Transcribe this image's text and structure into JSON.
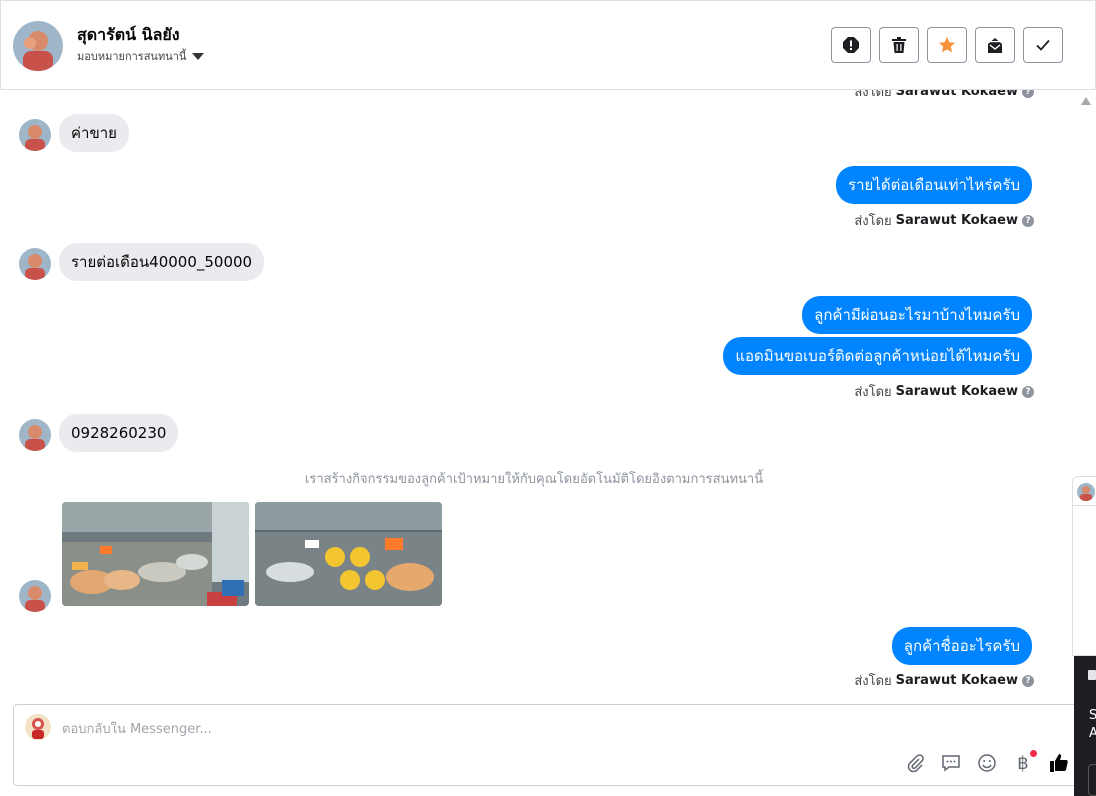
{
  "header": {
    "contact_name": "สุดารัตน์ นิลยัง",
    "assign_label": "มอบหมายการสนทนานี้"
  },
  "toolbar": {
    "icons": [
      "report-icon",
      "trash-icon",
      "star-icon",
      "mark-unread-icon",
      "check-icon"
    ],
    "star_color": "#f7923a"
  },
  "thread": {
    "top_sent_by_prefix": "ส่งโดย",
    "top_sent_by_name": "Sarawut Kokaew",
    "m1": "ค่าขาย",
    "m2": "รายได้ต่อเดือนเท่าไหร่ครับ",
    "m2_sent_by_prefix": "ส่งโดย",
    "m2_sent_by_name": "Sarawut Kokaew",
    "m3": "รายต่อเดือน40000_50000",
    "m4": "ลูกค้ามีผ่อนอะไรมาบ้างไหมครับ",
    "m5": "แอดมินขอเบอร์ติดต่อลูกค้าหน่อยได้ไหมครับ",
    "m5_sent_by_prefix": "ส่งโดย",
    "m5_sent_by_name": "Sarawut Kokaew",
    "m6": "0928260230",
    "system_note": "เราสร้างกิจกรรมของลูกค้าเป้าหมายให้กับคุณโดยอัตโนมัติโดยอิงตามการสนทนานี้",
    "m7": "ลูกค้าชื่ออะไรครับ",
    "m7_sent_by_prefix": "ส่งโดย",
    "m7_sent_by_name": "Sarawut Kokaew"
  },
  "composer": {
    "placeholder": "ตอบกลับใน Messenger...",
    "baht_symbol": "฿",
    "tools": [
      "attach-icon",
      "saved-reply-icon",
      "emoji-icon",
      "baht-icon",
      "thumbs-up-icon"
    ]
  },
  "side_peek": {
    "dark_letters": [
      "S",
      "A"
    ]
  },
  "colors": {
    "outgoing_bubble": "#0084ff",
    "incoming_bubble": "#e9ebee",
    "like_icon": "#050505"
  }
}
